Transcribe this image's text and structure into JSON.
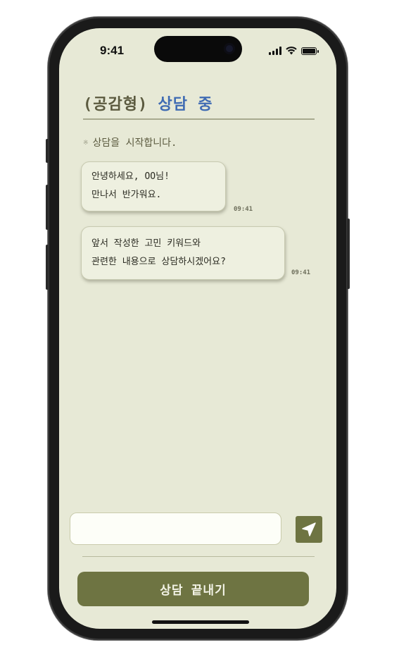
{
  "status_bar": {
    "time": "9:41"
  },
  "header": {
    "prefix": "(공감형)",
    "status": "상담 중"
  },
  "notice": "상담을 시작합니다.",
  "messages": [
    {
      "lines": [
        "안녕하세요, OO님!",
        "만나서 반가워요."
      ],
      "time": "09:41"
    },
    {
      "lines": [
        "앞서 작성한 고민 키워드와",
        "관련한 내용으로 상담하시겠어요?"
      ],
      "time": "09:41"
    }
  ],
  "input": {
    "value": "",
    "placeholder": ""
  },
  "end_button_label": "상담 끝내기",
  "colors": {
    "accent_blue": "#3f6bb3",
    "olive": "#6e7442",
    "background": "#e7e9d6"
  }
}
